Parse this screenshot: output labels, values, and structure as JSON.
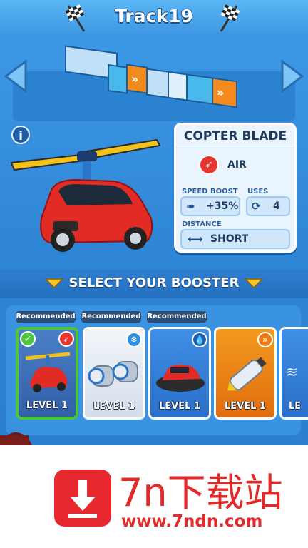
{
  "header": {
    "title": "Track19"
  },
  "booster": {
    "name": "COPTER BLADE",
    "type": "AIR",
    "speed_boost_label": "SPEED BOOST",
    "speed_boost_value": "+35%",
    "uses_label": "USES",
    "uses_value": "4",
    "distance_label": "DISTANCE",
    "distance_value": "SHORT"
  },
  "select": {
    "heading": "SELECT YOUR BOOSTER"
  },
  "boosters": [
    {
      "recommended": "Recommended",
      "level": "LEVEL 1",
      "selected": true,
      "color": "#e8352f",
      "icon": "wing-icon"
    },
    {
      "recommended": "Recommended",
      "level": "LEVEL 1",
      "selected": false,
      "color": "#dfe6ee",
      "icon": "snowflake-icon"
    },
    {
      "recommended": "Recommended",
      "level": "LEVEL 1",
      "selected": false,
      "color": "#2f78d8",
      "icon": "water-drop-icon"
    },
    {
      "recommended": "",
      "level": "LEVEL 1",
      "selected": false,
      "color": "#f07a12",
      "icon": "chevrons-icon"
    },
    {
      "recommended": "",
      "level": "LE",
      "selected": false,
      "color": "#2f78d8",
      "icon": "splash-icon"
    }
  ],
  "watermark": {
    "brand": "7n下载站",
    "url": "www.7ndn.com"
  },
  "colors": {
    "accent": "#3f9be8",
    "selected": "#4cc73b",
    "air": "#e8352f"
  }
}
